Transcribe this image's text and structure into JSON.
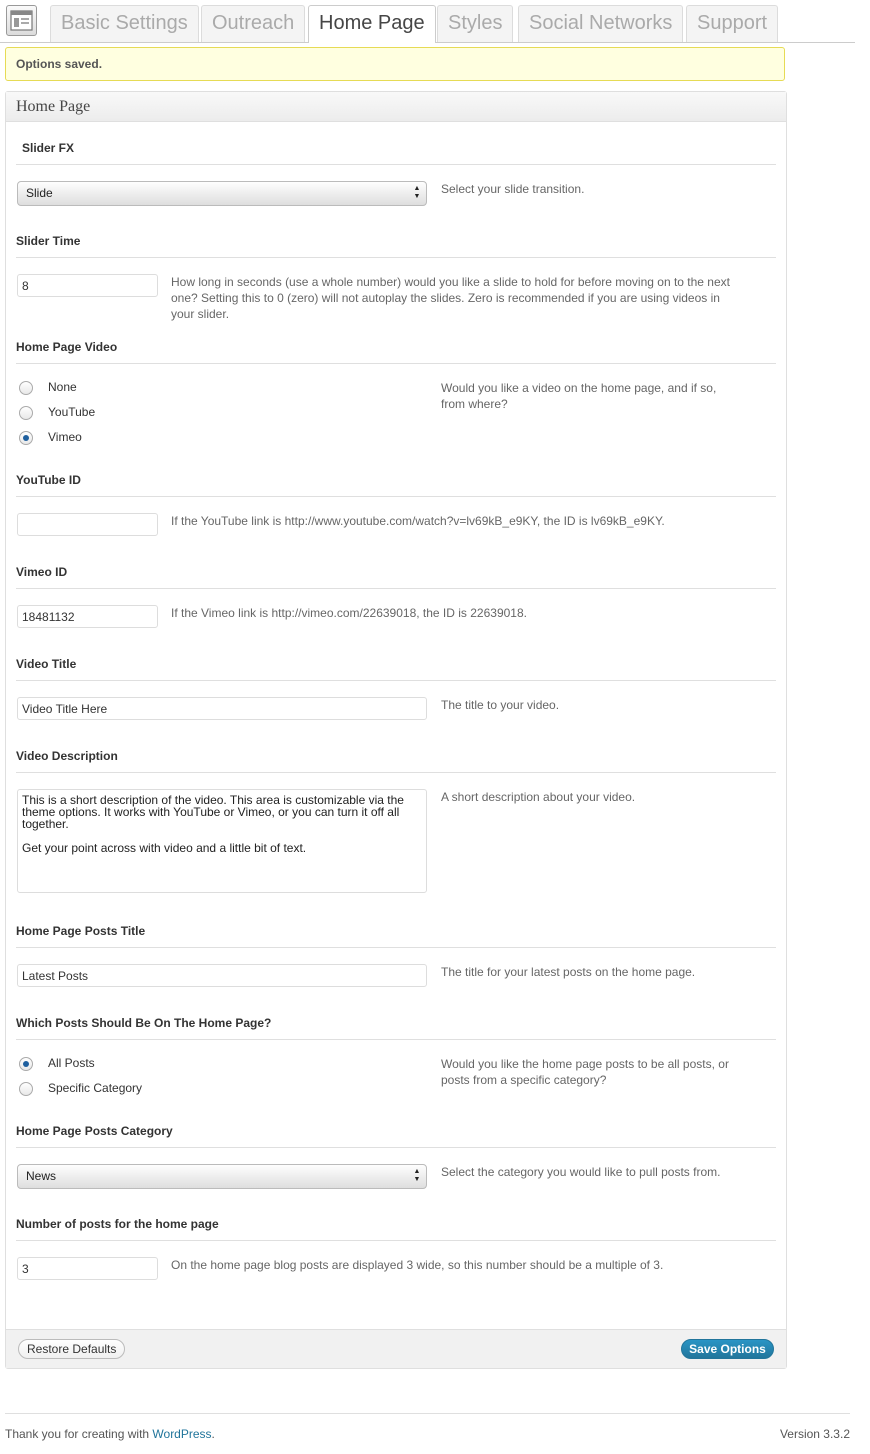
{
  "tabs": [
    "Basic Settings",
    "Outreach",
    "Home Page",
    "Styles",
    "Social Networks",
    "Support"
  ],
  "notice": "Options saved.",
  "panel_title": "Home Page",
  "slider_fx": {
    "title": "Slider FX",
    "value": "Slide",
    "desc": "Select your slide transition."
  },
  "slider_time": {
    "title": "Slider Time",
    "value": "8",
    "desc": "How long in seconds (use a whole number) would you like a slide to hold for before moving on to the next one? Setting this to 0 (zero) will not autoplay the slides. Zero is recommended if you are using videos in your slider."
  },
  "home_video": {
    "title": "Home Page Video",
    "options": [
      "None",
      "YouTube",
      "Vimeo"
    ],
    "selected": "Vimeo",
    "desc": "Would you like a video on the home page, and if so, from where?"
  },
  "youtube_id": {
    "title": "YouTube ID",
    "value": "",
    "desc": "If the YouTube link is http://www.youtube.com/watch?v=lv69kB_e9KY, the ID is lv69kB_e9KY."
  },
  "vimeo_id": {
    "title": "Vimeo ID",
    "value": "18481132",
    "desc": "If the Vimeo link is http://vimeo.com/22639018, the ID is 22639018."
  },
  "video_title": {
    "title": "Video Title",
    "value": "Video Title Here",
    "desc": "The title to your video."
  },
  "video_description": {
    "title": "Video Description",
    "value": "This is a short description of the video. This area is customizable via the theme options. It works with YouTube or Vimeo, or you can turn it off all together.\n\nGet your point across with video and a little bit of text.",
    "desc": "A short description about your video."
  },
  "posts_title": {
    "title": "Home Page Posts Title",
    "value": "Latest Posts",
    "desc": "The title for your latest posts on the home page."
  },
  "which_posts": {
    "title": "Which Posts Should Be On The Home Page?",
    "options": [
      "All Posts",
      "Specific Category"
    ],
    "selected": "All Posts",
    "desc": "Would you like the home page posts to be all posts, or posts from a specific category?"
  },
  "posts_category": {
    "title": "Home Page Posts Category",
    "value": "News",
    "desc": "Select the category you would like to pull posts from."
  },
  "num_posts": {
    "title": "Number of posts for the home page",
    "value": "3",
    "desc": "On the home page blog posts are displayed 3 wide, so this number should be a multiple of 3."
  },
  "buttons": {
    "restore": "Restore Defaults",
    "save": "Save Options"
  },
  "footer": {
    "text": "Thank you for creating with ",
    "link": "WordPress",
    "after": ".",
    "version": "Version 3.3.2"
  },
  "colors": {
    "accent": "#21759b",
    "notice_bg": "#ffffe0",
    "notice_border": "#e6db55"
  }
}
